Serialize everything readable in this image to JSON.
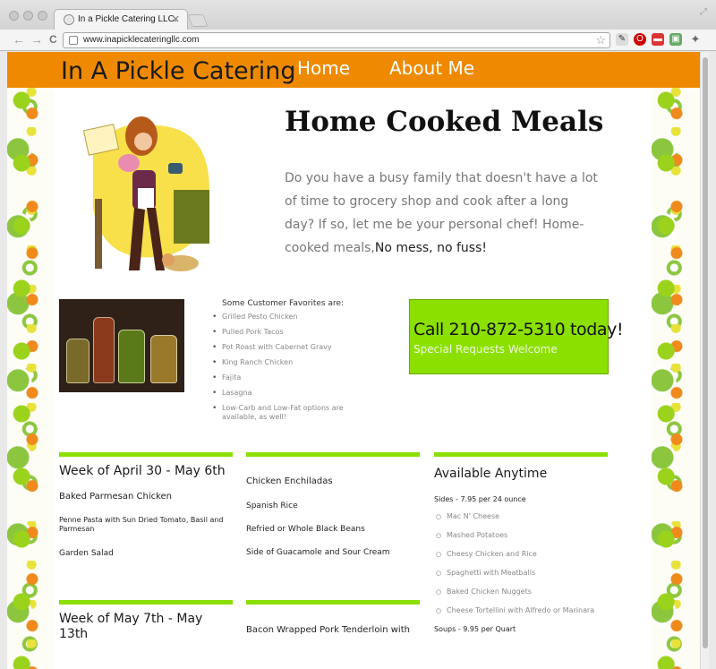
{
  "browser": {
    "tab_title": "In a Pickle Catering LLC.",
    "tab_close": "✕",
    "url": "www.inapicklecateringllc.com",
    "back": "←",
    "forward": "→",
    "reload": "C",
    "star": "☆"
  },
  "site": {
    "title": "In A Pickle Catering",
    "nav": [
      "Home",
      "About Me"
    ]
  },
  "hero": {
    "headline": "Home Cooked Meals",
    "intro": "Do you have a busy family that doesn't have a lot of time to grocery shop and cook after a long day? If so, let me be your personal chef! Home-cooked meals,",
    "intro_strong": "No mess, no fuss!"
  },
  "favorites": {
    "heading": "Some Customer Favorites are:",
    "items": [
      "Grilled Pesto Chicken",
      "Pulled Pork Tacos",
      "Pot Roast with Cabernet Gravy",
      "King Ranch Chicken",
      "Fajita",
      "Lasagna",
      "Low-Carb and Low-Fat options are available, as well!"
    ]
  },
  "callout": {
    "phone_text": "Call 210-872-5310 today!",
    "sub": "Special Requests Welcome"
  },
  "menus": {
    "week1": {
      "title": "Week of April 30 - May 6th",
      "items": [
        "Baked Parmesan Chicken",
        "Penne Pasta with Sun Dried Tomato, Basil and Parmesan",
        "Garden Salad"
      ]
    },
    "week1b": {
      "items": [
        "Chicken Enchiladas",
        "Spanish Rice",
        "Refried or Whole Black Beans",
        "Side of Guacamole and Sour Cream"
      ]
    },
    "week2": {
      "title": "Week of May 7th - May 13th",
      "items": [
        "Bacon Wrapped Pork Tenderloin with"
      ]
    },
    "anytime": {
      "title": "Available Anytime",
      "sides_label": "Sides - 7.95 per 24 ounce",
      "sides": [
        "Mac N' Cheese",
        "Mashed Potatoes",
        "Cheesy Chicken and Rice",
        "Spaghetti with Meatballs",
        "Baked Chicken Nuggets",
        "Cheese Tortellini with Alfredo or Marinara"
      ],
      "soups_label": "Soups - 9.95 per Quart"
    }
  },
  "colors": {
    "header_orange": "#ef8a00",
    "accent_green": "#8be000"
  }
}
